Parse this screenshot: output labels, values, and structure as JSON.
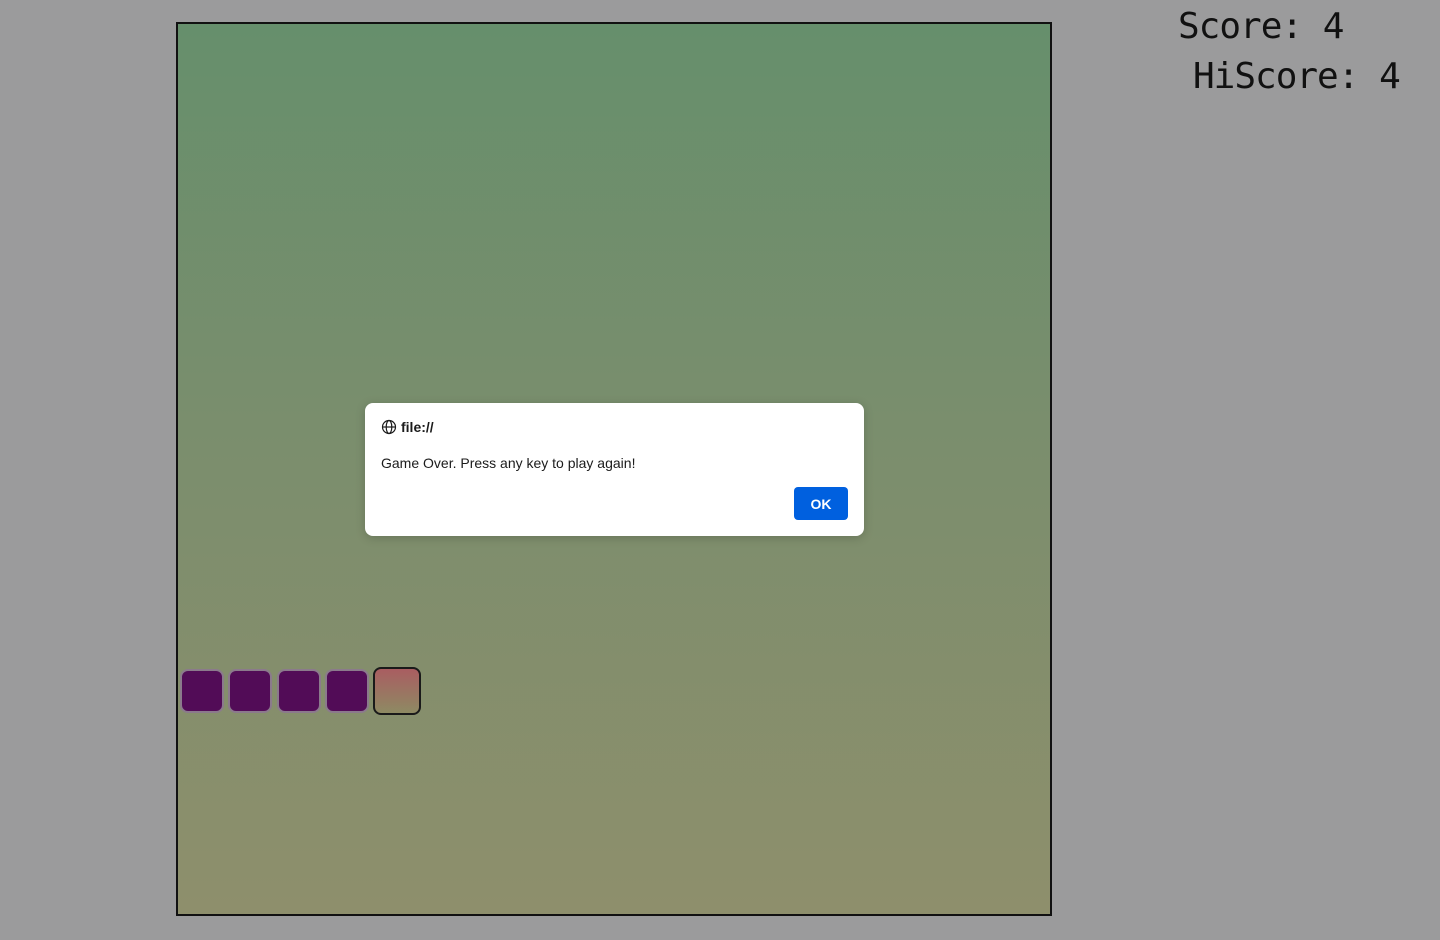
{
  "scoreboard": {
    "score_text": "Score: 4",
    "hiscore_text": "HiScore: 4"
  },
  "game": {
    "snake_length": 5,
    "colors": {
      "body": "#520c57",
      "head_top": "#a95d61",
      "head_bottom": "#8e8a63",
      "board_top": "#668f6c",
      "board_bottom": "#8e8f6c"
    }
  },
  "dialog": {
    "origin": "file://",
    "origin_icon": "globe-icon",
    "message": "Game Over. Press any key to play again!",
    "ok_label": "OK"
  }
}
